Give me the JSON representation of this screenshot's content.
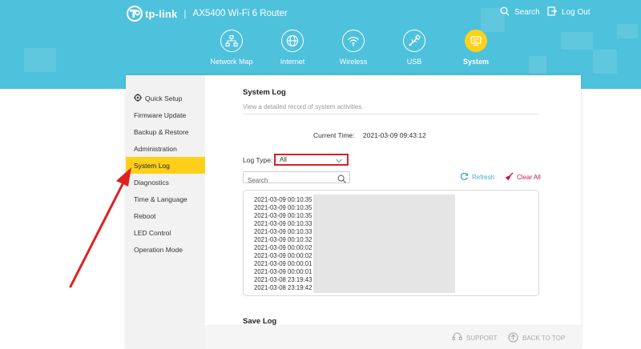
{
  "header": {
    "brand": "tp-link",
    "separator": "|",
    "model": "AX5400 Wi-Fi 6 Router",
    "search_label": "Search",
    "logout_label": "Log Out"
  },
  "nav": {
    "items": [
      {
        "label": "Network Map",
        "icon": "network-map-icon"
      },
      {
        "label": "Internet",
        "icon": "globe-icon"
      },
      {
        "label": "Wireless",
        "icon": "wifi-icon"
      },
      {
        "label": "USB",
        "icon": "usb-icon"
      },
      {
        "label": "System",
        "icon": "system-icon",
        "active": true
      }
    ]
  },
  "sidebar": {
    "items": [
      {
        "label": "Quick Setup",
        "icon": "quick-setup-icon"
      },
      {
        "label": "Firmware Update"
      },
      {
        "label": "Backup & Restore"
      },
      {
        "label": "Administration"
      },
      {
        "label": "System Log",
        "active": true
      },
      {
        "label": "Diagnostics"
      },
      {
        "label": "Time & Language"
      },
      {
        "label": "Reboot"
      },
      {
        "label": "LED Control"
      },
      {
        "label": "Operation Mode"
      }
    ]
  },
  "system_log": {
    "title": "System Log",
    "description": "View a detailed record of system activities.",
    "current_time_label": "Current Time:",
    "current_time": "2021-03-09 09:43:12",
    "log_type_label": "Log Type:",
    "log_type_value": "All",
    "search_placeholder": "Search",
    "refresh_label": "Refresh",
    "clear_label": "Clear All",
    "entries": [
      "2021-03-09 00:10:35",
      "2021-03-09 00:10:35",
      "2021-03-09 00:10:35",
      "2021-03-09 00:10:33",
      "2021-03-09 00:10:33",
      "2021-03-09 00:10:32",
      "2021-03-09 00:00:02",
      "2021-03-09 00:00:02",
      "2021-03-09 00:00:01",
      "2021-03-09 00:00:01",
      "2021-03-08 23:19:43",
      "2021-03-08 23:19:42"
    ]
  },
  "save_log": {
    "title": "Save Log"
  },
  "footer": {
    "support_label": "SUPPORT",
    "back_to_top_label": "BACK TO TOP"
  },
  "colors": {
    "header_bg": "#4ec1dc",
    "active_yellow": "#ffcf1a",
    "highlight_red": "#d8202a",
    "refresh": "#4aaac8",
    "clear": "#c2185b",
    "arrow": "#e02020"
  }
}
